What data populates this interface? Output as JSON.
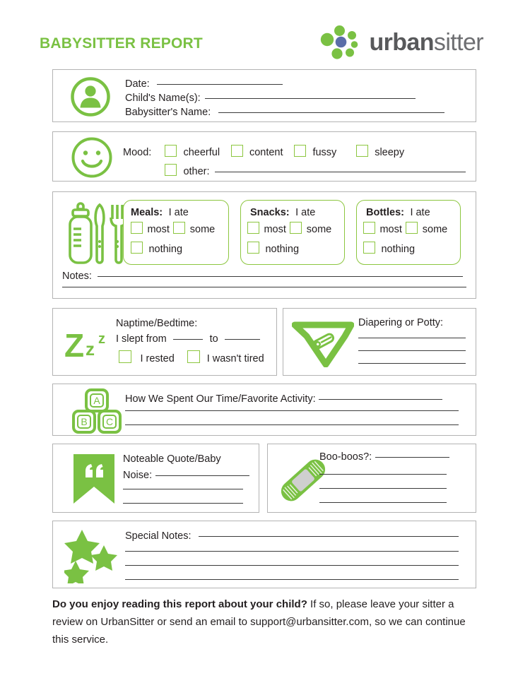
{
  "header": {
    "title": "BABYSITTER REPORT",
    "logo_bold": "urban",
    "logo_light": "sitter",
    "logo_icon": "urbansitter-dots-logo"
  },
  "colors": {
    "brand_green": "#7ac143",
    "icon_green": "#8cc63f",
    "logo_blue": "#5b6ea8",
    "box_border": "#b3b3b3",
    "text": "#231f20"
  },
  "info": {
    "icon": "person-icon",
    "fields": [
      {
        "label": "Date:",
        "line_width": 178
      },
      {
        "label": "Child's Name(s):",
        "line_width": 298
      },
      {
        "label": "Babysitter's Name:",
        "line_width": 320
      }
    ]
  },
  "mood": {
    "icon": "smiley-face-icon",
    "label": "Mood:",
    "options": [
      "cheerful",
      "content",
      "fussy",
      "sleepy"
    ],
    "other_label": "other:",
    "other_line_width": 355
  },
  "food": {
    "icon": "bottle-utensils-icon",
    "groups": [
      {
        "title": "Meals:",
        "suffix": "I ate",
        "options": [
          "most",
          "some",
          "nothing"
        ]
      },
      {
        "title": "Snacks:",
        "suffix": "I ate",
        "options": [
          "most",
          "some",
          "nothing"
        ]
      },
      {
        "title": "Bottles:",
        "suffix": "I ate",
        "options": [
          "most",
          "some",
          "nothing"
        ]
      }
    ],
    "notes_label": "Notes:",
    "notes_lines": 2
  },
  "nap": {
    "icon": "zzz-sleep-icon",
    "title": "Naptime/Bedtime:",
    "slept_prefix": "I slept from",
    "slept_mid": "to",
    "checks": [
      "I rested",
      "I wasn't tired"
    ]
  },
  "diaper": {
    "icon": "diaper-icon",
    "title": "Diapering or Potty:",
    "lines": 3
  },
  "activity": {
    "icon": "abc-blocks-icon",
    "blocks": [
      "A",
      "B",
      "C"
    ],
    "title": "How We Spent Our Time/Favorite Activity:",
    "lines": 2
  },
  "quote": {
    "icon": "quote-ribbon-icon",
    "title_line1": "Noteable Quote/Baby",
    "title_line2": "Noise:",
    "lines": 2
  },
  "booboos": {
    "icon": "bandage-icon",
    "title": "Boo-boos?:",
    "lines": 3
  },
  "special": {
    "icon": "stars-icon",
    "title": "Special Notes:",
    "lines": 3
  },
  "footer": {
    "bold_text": "Do you enjoy reading this report about your child?",
    "rest_text": " If so, please leave your sitter a review on UrbanSitter or send an email to support@urbansitter.com, so we can continue this service."
  }
}
